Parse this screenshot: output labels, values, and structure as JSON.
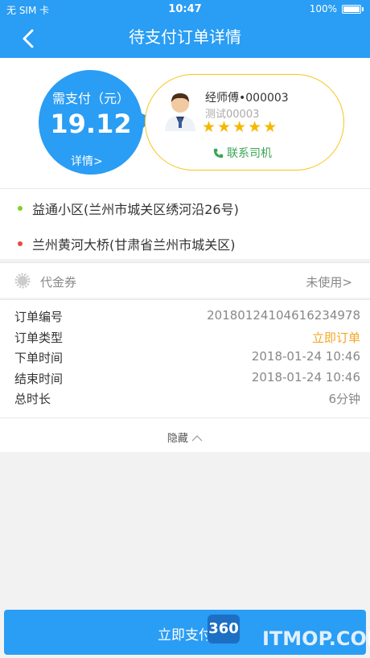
{
  "status": {
    "carrier": "无 SIM 卡",
    "time": "10:47",
    "battery": "100%"
  },
  "header": {
    "title": "待支付订单详情"
  },
  "payment": {
    "label": "需支付（元）",
    "amount": "19.12",
    "details_link": "详情>"
  },
  "driver": {
    "name": "经师傅•000003",
    "subtitle": "测试00003",
    "stars": 5,
    "contact": "联系司机"
  },
  "addresses": {
    "start": "益通小区(兰州市城关区绣河沿26号)",
    "end": "兰州黄河大桥(甘肃省兰州市城关区)"
  },
  "coupon": {
    "label": "代金券",
    "value": "未使用>"
  },
  "order": {
    "rows": [
      {
        "key": "订单编号",
        "value": "20180124104616234978"
      },
      {
        "key": "订单类型",
        "value": "立即订单"
      },
      {
        "key": "下单时间",
        "value": "2018-01-24 10:46"
      },
      {
        "key": "结束时间",
        "value": "2018-01-24 10:46"
      },
      {
        "key": "总时长",
        "value": "6分钟"
      }
    ],
    "toggle": "隐藏"
  },
  "pay_button": "立即支付",
  "watermark": {
    "badge": "360",
    "text": "ITMOP.COM"
  },
  "colors": {
    "primary": "#2a9df4",
    "accent": "#f5a623",
    "star": "#f5b800",
    "green": "#3aa655"
  }
}
